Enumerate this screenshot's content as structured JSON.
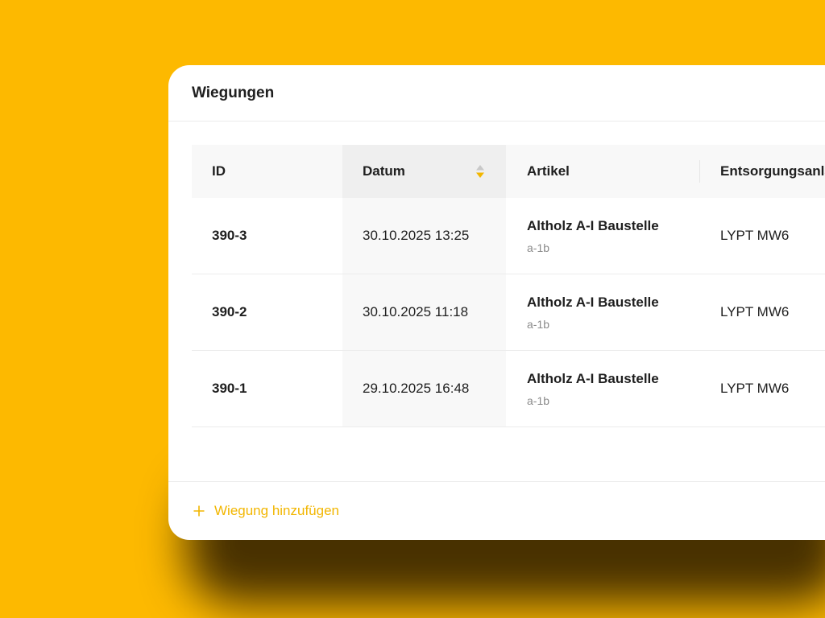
{
  "card": {
    "title": "Wiegungen"
  },
  "table": {
    "columns": [
      {
        "label": "ID"
      },
      {
        "label": "Datum",
        "sortable": true,
        "sort_icon": "sort-up-down-icon"
      },
      {
        "label": "Artikel"
      },
      {
        "label": "Entsorgungsanlage"
      }
    ],
    "rows": [
      {
        "id": "390-3",
        "datum": "30.10.2025 13:25",
        "artikel": "Altholz A-I Baustelle",
        "artikel_code": "a-1b",
        "entsorgung": "LYPT MW6"
      },
      {
        "id": "390-2",
        "datum": "30.10.2025 11:18",
        "artikel": "Altholz A-I Baustelle",
        "artikel_code": "a-1b",
        "entsorgung": "LYPT MW6"
      },
      {
        "id": "390-1",
        "datum": "29.10.2025 16:48",
        "artikel": "Altholz A-I Baustelle",
        "artikel_code": "a-1b",
        "entsorgung": "LYPT MW6"
      }
    ]
  },
  "footer": {
    "add_label": "Wiegung hinzufügen",
    "add_icon": "plus-icon"
  },
  "colors": {
    "background": "#FDB900",
    "accent": "#F2B600",
    "sort_active": "#F2B600",
    "sort_inactive": "#c8c8c8"
  }
}
